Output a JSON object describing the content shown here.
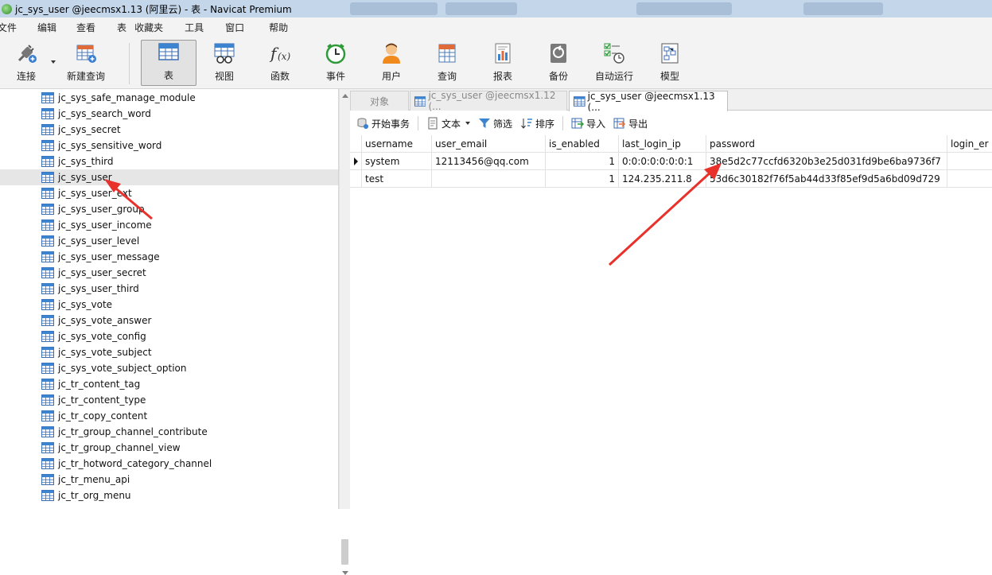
{
  "window": {
    "title": "jc_sys_user @jeecmsx1.13 (阿里云) - 表 - Navicat Premium"
  },
  "menu": [
    "文件",
    "编辑",
    "查看",
    "表",
    "收藏夹",
    "工具",
    "窗口",
    "帮助"
  ],
  "toolbar": {
    "connect": "连接",
    "new_query": "新建查询",
    "table": "表",
    "view": "视图",
    "function": "函数",
    "event": "事件",
    "user": "用户",
    "query": "查询",
    "report": "报表",
    "backup": "备份",
    "schedule": "自动运行",
    "model": "模型"
  },
  "tree": [
    "jc_sys_safe_manage_module",
    "jc_sys_search_word",
    "jc_sys_secret",
    "jc_sys_sensitive_word",
    "jc_sys_third",
    "jc_sys_user",
    "jc_sys_user_ext",
    "jc_sys_user_group",
    "jc_sys_user_income",
    "jc_sys_user_level",
    "jc_sys_user_message",
    "jc_sys_user_secret",
    "jc_sys_user_third",
    "jc_sys_vote",
    "jc_sys_vote_answer",
    "jc_sys_vote_config",
    "jc_sys_vote_subject",
    "jc_sys_vote_subject_option",
    "jc_tr_content_tag",
    "jc_tr_content_type",
    "jc_tr_copy_content",
    "jc_tr_group_channel_contribute",
    "jc_tr_group_channel_view",
    "jc_tr_hotword_category_channel",
    "jc_tr_menu_api",
    "jc_tr_org_menu"
  ],
  "tree_selected": "jc_sys_user",
  "tabs": {
    "objects": "对象",
    "tab1": "jc_sys_user @jeecmsx1.12 (...",
    "tab2": "jc_sys_user @jeecmsx1.13 (..."
  },
  "subtoolbar": {
    "begin_transaction": "开始事务",
    "text": "文本",
    "filter": "筛选",
    "sort": "排序",
    "import": "导入",
    "export": "导出"
  },
  "table": {
    "columns": [
      "username",
      "user_email",
      "is_enabled",
      "last_login_ip",
      "password",
      "login_er"
    ],
    "rows": [
      {
        "username": "system",
        "user_email": "12113456@qq.com",
        "is_enabled": "1",
        "last_login_ip": "0:0:0:0:0:0:0:1",
        "password": "38e5d2c77ccfd6320b3e25d031fd9be6ba9736f7"
      },
      {
        "username": "test",
        "user_email": "",
        "is_enabled": "1",
        "last_login_ip": "124.235.211.8",
        "password": "53d6c30182f76f5ab44d33f85ef9d5a6bd09d729"
      }
    ]
  },
  "colors": {
    "annotation_arrow": "#e8312b",
    "titlebar": "#c4d6ea",
    "toolbar_bg": "#f3f3f3"
  }
}
